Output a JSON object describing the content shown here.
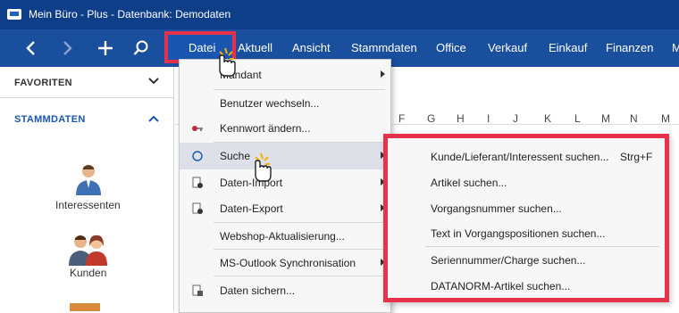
{
  "window": {
    "title": "Mein Büro - Plus - Datenbank: Demodaten"
  },
  "menubar": {
    "items": [
      "Datei",
      "Aktuell",
      "Ansicht",
      "Stammdaten",
      "Office",
      "Verkauf",
      "Einkauf",
      "Finanzen",
      "M"
    ]
  },
  "sidebar": {
    "favoriten": "FAVORITEN",
    "stammdaten": "STAMMDATEN",
    "items": [
      "Interessenten",
      "Kunden"
    ]
  },
  "columns": [
    "F",
    "G",
    "H",
    "I",
    "J",
    "K",
    "L",
    "M",
    "N"
  ],
  "datei_menu": {
    "items": [
      {
        "label": "Mandant",
        "submenu": true
      },
      {
        "label": "Benutzer wechseln..."
      },
      {
        "label": "Kennwort ändern..."
      },
      {
        "label": "Suche",
        "submenu": true
      },
      {
        "label": "Daten-Import",
        "submenu": true
      },
      {
        "label": "Daten-Export",
        "submenu": true
      },
      {
        "label": "Webshop-Aktualisierung..."
      },
      {
        "label": "MS-Outlook Synchronisation",
        "submenu": true
      },
      {
        "label": "Daten sichern..."
      }
    ]
  },
  "suche_submenu": {
    "items": [
      {
        "label": "Kunde/Lieferant/Interessent suchen...",
        "shortcut": "Strg+F"
      },
      {
        "label": "Artikel suchen..."
      },
      {
        "label": "Vorgangsnummer suchen..."
      },
      {
        "label": "Text in Vorgangspositionen suchen..."
      },
      {
        "label": "Seriennummer/Charge suchen..."
      },
      {
        "label": "DATANORM-Artikel suchen..."
      }
    ]
  },
  "colors": {
    "titlebar": "#0f3e88",
    "menubar": "#1a4f9e",
    "highlight": "#e8324b",
    "accent": "#1a56b0"
  }
}
